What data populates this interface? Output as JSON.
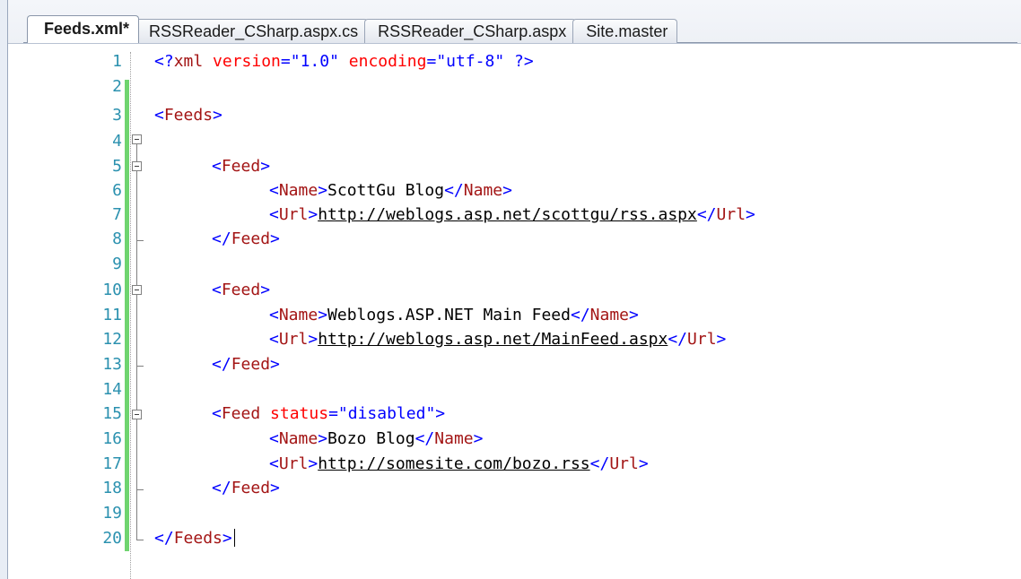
{
  "tabs": [
    {
      "label": "Feeds.xml*",
      "active": true
    },
    {
      "label": "RSSReader_CSharp.aspx.cs",
      "active": false
    },
    {
      "label": "RSSReader_CSharp.aspx",
      "active": false
    },
    {
      "label": "Site.master",
      "active": false
    }
  ],
  "editor": {
    "line_numbers": [
      "1",
      "2",
      "3",
      "4",
      "5",
      "6",
      "7",
      "8",
      "9",
      "10",
      "11",
      "12",
      "13",
      "14",
      "15",
      "16",
      "17",
      "18",
      "19",
      "20"
    ],
    "lines": {
      "l1": {
        "open": "<?",
        "name": "xml",
        "a1": " version",
        "eq1": "=",
        "v1": "\"1.0\"",
        "a2": " encoding",
        "eq2": "=",
        "v2": "\"utf-8\"",
        "close": " ?>"
      },
      "l3": {
        "lt": "<",
        "name": "Feeds",
        "gt": ">"
      },
      "l5": {
        "lt": "<",
        "name": "Feed",
        "gt": ">"
      },
      "l6": {
        "lt": "<",
        "name": "Name",
        "gt": ">",
        "text": "ScottGu Blog",
        "lt2": "</",
        "name2": "Name",
        "gt2": ">"
      },
      "l7": {
        "lt": "<",
        "name": "Url",
        "gt": ">",
        "text": "http://weblogs.asp.net/scottgu/rss.aspx",
        "lt2": "</",
        "name2": "Url",
        "gt2": ">"
      },
      "l8": {
        "lt": "</",
        "name": "Feed",
        "gt": ">"
      },
      "l10": {
        "lt": "<",
        "name": "Feed",
        "gt": ">"
      },
      "l11": {
        "lt": "<",
        "name": "Name",
        "gt": ">",
        "text": "Weblogs.ASP.NET Main Feed",
        "lt2": "</",
        "name2": "Name",
        "gt2": ">"
      },
      "l12": {
        "lt": "<",
        "name": "Url",
        "gt": ">",
        "text": "http://weblogs.asp.net/MainFeed.aspx",
        "lt2": "</",
        "name2": "Url",
        "gt2": ">"
      },
      "l13": {
        "lt": "</",
        "name": "Feed",
        "gt": ">"
      },
      "l15": {
        "lt": "<",
        "name": "Feed",
        "attr": " status",
        "eq": "=",
        "val": "\"disabled\"",
        "gt": ">"
      },
      "l16": {
        "lt": "<",
        "name": "Name",
        "gt": ">",
        "text": "Bozo Blog",
        "lt2": "</",
        "name2": "Name",
        "gt2": ">"
      },
      "l17": {
        "lt": "<",
        "name": "Url",
        "gt": ">",
        "text": "http://somesite.com/bozo.rss",
        "lt2": "</",
        "name2": "Url",
        "gt2": ">"
      },
      "l18": {
        "lt": "</",
        "name": "Feed",
        "gt": ">"
      },
      "l20": {
        "lt": "</",
        "name": "Feeds",
        "gt": ">"
      }
    }
  },
  "colors": {
    "punctuation": "#0000ff",
    "tag_name": "#a31515",
    "attribute": "#ff0000",
    "attribute_value": "#0000ff",
    "line_number": "#2b91af",
    "change_bar": "#6fd46f"
  }
}
